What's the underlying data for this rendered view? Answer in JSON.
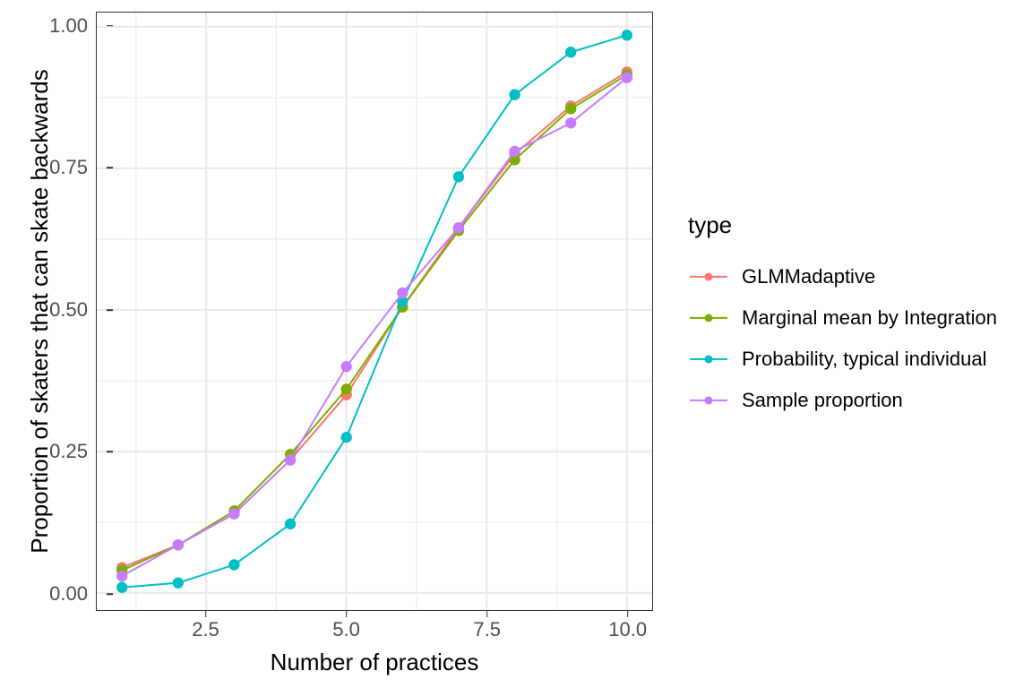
{
  "chart_data": {
    "type": "line",
    "title": "",
    "xlabel": "Number of practices",
    "ylabel": "Proportion of skaters that can skate backwards",
    "x": [
      1,
      2,
      3,
      4,
      5,
      6,
      7,
      8,
      9,
      10
    ],
    "xlim": [
      0.55,
      10.45
    ],
    "ylim": [
      -0.03,
      1.025
    ],
    "x_ticks": [
      "2.5",
      "5.0",
      "7.5",
      "10.0"
    ],
    "x_tick_values": [
      2.5,
      5.0,
      7.5,
      10.0
    ],
    "y_ticks": [
      "0.00",
      "0.25",
      "0.50",
      "0.75",
      "1.00"
    ],
    "y_tick_values": [
      0.0,
      0.25,
      0.5,
      0.75,
      1.0
    ],
    "grid": true,
    "grid_color": "#ebebeb",
    "panel_background": "#ffffff",
    "legend_position": "right",
    "legend_title": "type",
    "series": [
      {
        "name": "GLMMadaptive",
        "color": "#F8766D",
        "values": [
          0.045,
          0.085,
          0.14,
          0.235,
          0.35,
          0.505,
          0.645,
          0.775,
          0.86,
          0.92
        ]
      },
      {
        "name": "Marginal mean by Integration",
        "color": "#7CAE00",
        "values": [
          0.04,
          0.085,
          0.145,
          0.245,
          0.36,
          0.505,
          0.64,
          0.765,
          0.855,
          0.915
        ]
      },
      {
        "name": "Probability, typical individual",
        "color": "#00BFC4",
        "values": [
          0.01,
          0.018,
          0.05,
          0.122,
          0.275,
          0.515,
          0.735,
          0.88,
          0.955,
          0.985
        ]
      },
      {
        "name": "Sample proportion",
        "color": "#C77CFF",
        "values": [
          0.03,
          0.085,
          0.14,
          0.235,
          0.4,
          0.53,
          0.645,
          0.78,
          0.83,
          0.91
        ]
      }
    ]
  }
}
